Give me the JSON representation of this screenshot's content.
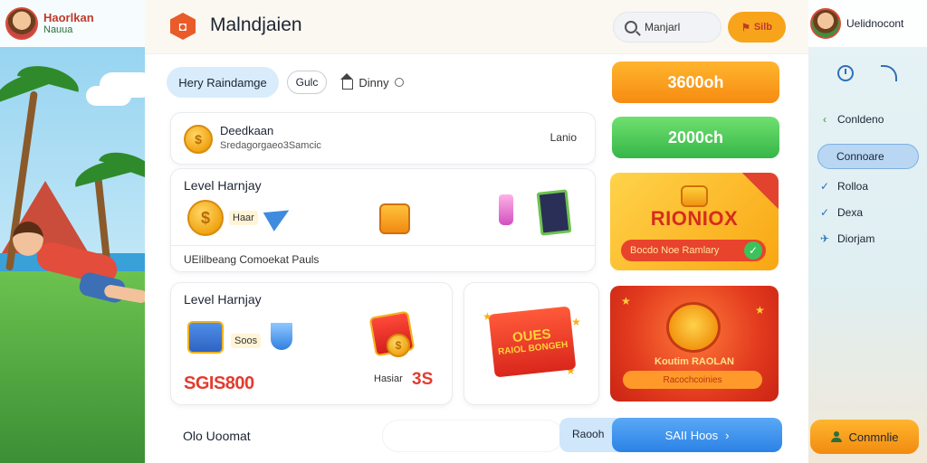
{
  "left_panel": {
    "brand_title": "Haorlkan",
    "brand_subtitle": "Nauua"
  },
  "header": {
    "app_title": "Malndjaien",
    "search_text": "Manjarl",
    "top_pill_label": "Silb"
  },
  "chips": {
    "active": "Hery Raindamge",
    "plain": "Gulc",
    "house": "Dinny"
  },
  "user_card": {
    "name": "Deedkaan",
    "subtitle": "Sredagorgaeo3Samcic",
    "action": "Lanio"
  },
  "level_card_1": {
    "title": "Level Harnjay",
    "tag": "Haar",
    "footer": "UElilbeang Comoekat Pauls"
  },
  "level_card_2": {
    "title": "Level Harnjay",
    "tag": "Soos",
    "amount": "SGIS800",
    "small_tag": "Hasiar",
    "red_number": "3S"
  },
  "gift_card": {
    "line1": "OUES",
    "line2": "RAIOL BONGEH"
  },
  "amount_buttons": {
    "orange": "3600oh",
    "green": "2000ch"
  },
  "promo_card": {
    "title": "RIONIOX",
    "bar_label": "Bocdo Noe Ramlary"
  },
  "reward_card": {
    "title": "Koutim RAOLAN",
    "bar_label": "Racochcoinies"
  },
  "bottom": {
    "label": "Olo Uoomat",
    "pill_left": "Raooh",
    "pill_button": "SAII Hoos"
  },
  "right_panel": {
    "title": "Uelidnocont",
    "items": [
      {
        "label": "Conldeno",
        "icon": "back-arrow-icon"
      },
      {
        "label": "Connoare",
        "icon": "none"
      },
      {
        "label": "Rolloa",
        "icon": "check-icon"
      },
      {
        "label": "Dexa",
        "icon": "check-icon"
      },
      {
        "label": "Diorjam",
        "icon": "plane-icon"
      }
    ],
    "bottom_button": "Conmnlie"
  },
  "colors": {
    "accent_orange": "#f68b12",
    "accent_green": "#36b648",
    "accent_blue": "#2c83e6",
    "accent_red": "#e23a1e"
  }
}
